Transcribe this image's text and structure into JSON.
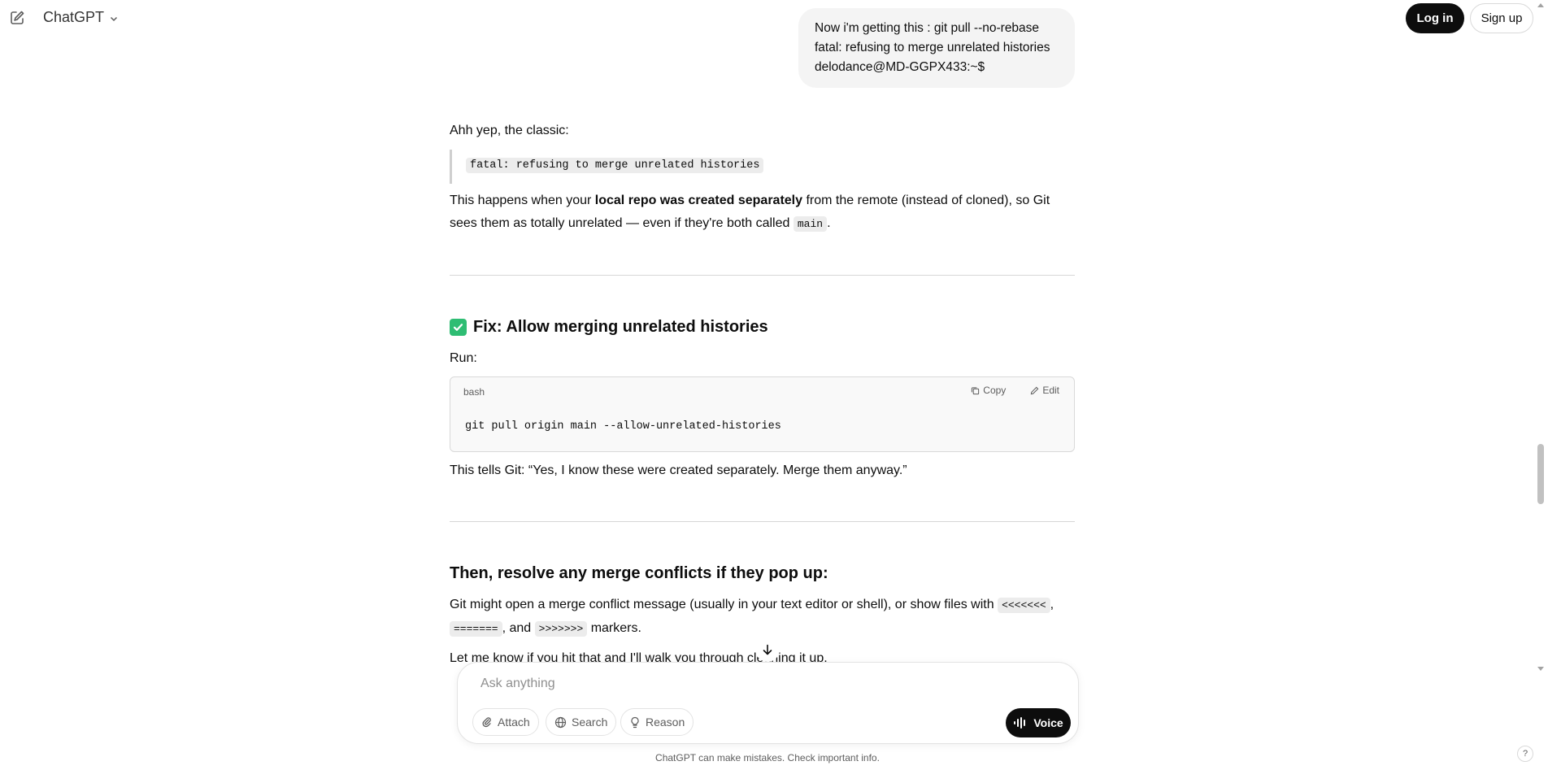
{
  "header": {
    "brand": "ChatGPT",
    "login_label": "Log in",
    "signup_label": "Sign up"
  },
  "user_message": {
    "lines": [
      "Now i'm getting this :  git pull --no-rebase",
      "fatal: refusing to merge unrelated histories",
      "delodance@MD-GGPX433:~$"
    ]
  },
  "assistant": {
    "intro": "Ahh yep, the classic:",
    "quote_code": "fatal: refusing to merge unrelated histories",
    "explain": {
      "before": "This happens when your ",
      "bold": "local repo was created separately",
      "after": " from the remote (instead of cloned), so Git sees them as totally unrelated — even if they're both called ",
      "code": "main",
      "end": "."
    },
    "fix_heading": "Fix: Allow merging unrelated histories",
    "run_label": "Run:",
    "code_block": {
      "language": "bash",
      "copy_label": "Copy",
      "edit_label": "Edit",
      "code": "git pull origin main --allow-unrelated-histories"
    },
    "tells_git": "This tells Git: “Yes, I know these were created separately. Merge them anyway.”",
    "resolve_heading": "Then, resolve any merge conflicts if they pop up:",
    "conflict": {
      "before": "Git might open a merge conflict message (usually in your text editor or shell), or show files with ",
      "code1": "<<<<<<<",
      "sep1": ",",
      "code2": "=======",
      "sep2": ", and ",
      "code3": ">>>>>>>",
      "after": " markers."
    },
    "last_line": "Let me know if you hit that and I'll walk you through cleaning it up."
  },
  "composer": {
    "placeholder": "Ask anything",
    "attach_label": "Attach",
    "search_label": "Search",
    "reason_label": "Reason",
    "voice_label": "Voice"
  },
  "footer": {
    "disclaimer": "ChatGPT can make mistakes. Check important info.",
    "help": "?"
  },
  "colors": {
    "accent_check": "#2ebd73",
    "primary_button": "#0d0d0d",
    "bubble_bg": "#f4f4f4"
  }
}
